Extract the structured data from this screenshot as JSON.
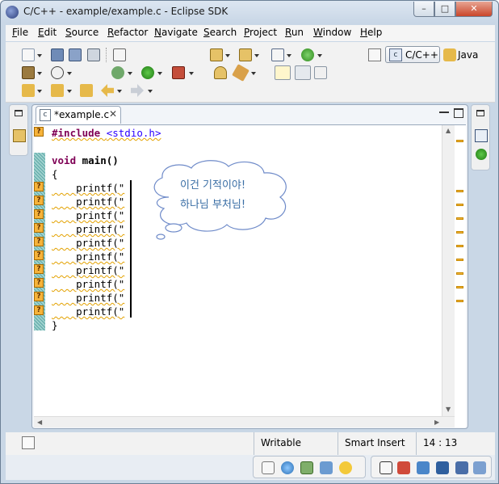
{
  "window": {
    "title": "C/C++ - example/example.c - Eclipse SDK"
  },
  "window_controls": {
    "minimize": "–",
    "maximize": "□",
    "close": "✕"
  },
  "menu": [
    "File",
    "Edit",
    "Source",
    "Refactor",
    "Navigate",
    "Search",
    "Project",
    "Run",
    "Window",
    "Help"
  ],
  "perspectives": {
    "active": "C/C++",
    "active_icon": "c",
    "other": "Java"
  },
  "editor": {
    "tab_label": "*example.c",
    "tab_icon": "c",
    "tab_close": "✕",
    "code_lines": [
      {
        "text": "#include <stdio.h>",
        "kind": "include"
      },
      {
        "text": "",
        "kind": "blank"
      },
      {
        "text": "void main()",
        "kind": "decl"
      },
      {
        "text": "{",
        "kind": "plain"
      },
      {
        "text": "    printf(\"",
        "kind": "printf"
      },
      {
        "text": "    printf(\"",
        "kind": "printf"
      },
      {
        "text": "    printf(\"",
        "kind": "printf"
      },
      {
        "text": "    printf(\"",
        "kind": "printf"
      },
      {
        "text": "    printf(\"",
        "kind": "printf"
      },
      {
        "text": "    printf(\"",
        "kind": "printf"
      },
      {
        "text": "    printf(\"",
        "kind": "printf"
      },
      {
        "text": "    printf(\"",
        "kind": "printf"
      },
      {
        "text": "    printf(\"",
        "kind": "printf"
      },
      {
        "text": "    printf(\"",
        "kind": "printf"
      },
      {
        "text": "}",
        "kind": "plain"
      }
    ],
    "annotation_glyph": "?"
  },
  "bubble": {
    "line1": "이건 기적이야!",
    "line2": "하나님 부처님!"
  },
  "status": {
    "writable": "Writable",
    "insert_mode": "Smart Insert",
    "position": "14 : 13"
  },
  "colors": {
    "keyword": "#7f0055",
    "include_file": "#2a00ff",
    "warning": "#f6b33a",
    "bubble_text": "#3a6ea5"
  }
}
